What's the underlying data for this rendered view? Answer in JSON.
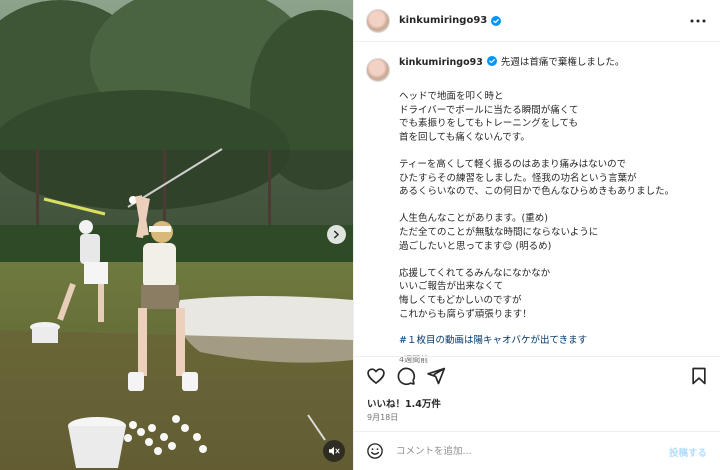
{
  "post": {
    "username": "kinkumiringo93",
    "caption_first_line": "先週は首痛で棄権しました。",
    "caption_body": "ヘッドで地面を叩く時と\nドライバーでボールに当たる瞬間が痛くて\nでも素振りをしてもトレーニングをしても\n首を回しても痛くないんです。\n\nティーを高くして軽く振るのはあまり痛みはないので\nひたすらその練習をしました。怪我の功名という言葉が\nあるくらいなので、この何日かで色んなひらめきもありました。\n\n人生色んなことがあります。(重め)\nただ全てのことが無駄な時間にならないように\n過ごしたいと思ってます😊 (明るめ)\n\n応援してくれてるみんなになかなか\nいいご報告が出来なくて\n悔しくてもどかしいのですが\nこれからも腐らず頑張ります！",
    "hashtag": "#１枚目の動画は陽キャオバケが出てきます",
    "time_ago": "4週間前",
    "likes": "いいね！1.4万件",
    "date": "9月18日"
  },
  "comment": {
    "placeholder": "コメントを追加...",
    "post_label": "投稿する"
  },
  "icons": {
    "verified": "verified-badge-icon",
    "more": "more-options-icon",
    "like": "heart-icon",
    "comment": "comment-icon",
    "share": "share-icon",
    "save": "bookmark-icon",
    "emoji": "emoji-icon",
    "next": "chevron-right-icon",
    "mute": "speaker-muted-icon"
  },
  "colors": {
    "verified_blue": "#0095f6",
    "hashtag_blue": "#00376b",
    "post_button_disabled": "#b2dffc"
  }
}
